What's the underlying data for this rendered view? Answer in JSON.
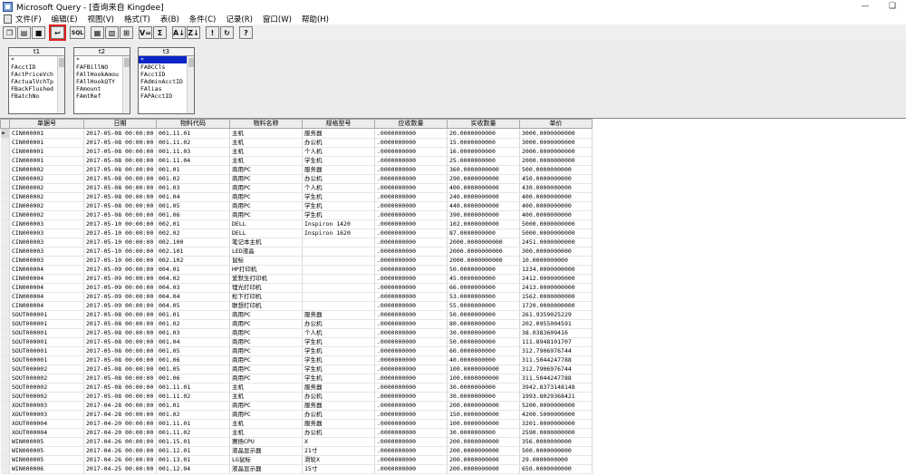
{
  "window": {
    "title": "Microsoft Query - [查询来自 Kingdee]",
    "controls": [
      "—",
      "❏"
    ]
  },
  "menu": [
    "文件(F)",
    "编辑(E)",
    "视图(V)",
    "格式(T)",
    "表(B)",
    "条件(C)",
    "记录(R)",
    "窗口(W)",
    "帮助(H)"
  ],
  "toolbar": {
    "buttons": [
      {
        "name": "new-query-button",
        "glyph": "❐"
      },
      {
        "name": "open-query-button",
        "glyph": "▤"
      },
      {
        "name": "save-query-button",
        "glyph": "■"
      },
      {
        "name": "return-data-button",
        "glyph": "↩",
        "highlight": true
      },
      {
        "name": "view-sql-button",
        "glyph": "SQL",
        "wide": true
      },
      {
        "name": "show-tables-button",
        "glyph": "▦"
      },
      {
        "name": "show-criteria-button",
        "glyph": "▧"
      },
      {
        "name": "add-tables-button",
        "glyph": "⊞"
      },
      {
        "name": "criteria-equals-button",
        "glyph": "V="
      },
      {
        "name": "totals-button",
        "glyph": "Σ"
      },
      {
        "name": "sort-ascending-button",
        "glyph": "A↓"
      },
      {
        "name": "sort-descending-button",
        "glyph": "Z↓"
      },
      {
        "name": "query-now-button",
        "glyph": "!"
      },
      {
        "name": "auto-query-button",
        "glyph": "↻"
      },
      {
        "name": "help-button",
        "glyph": "?"
      }
    ]
  },
  "tables": [
    {
      "title": "t1",
      "fields": [
        "*",
        "FAcctID",
        "FActPriceVch",
        "FActualVchTp",
        "FBackFlushed",
        "FBatchNo"
      ],
      "selected": -1
    },
    {
      "title": "t2",
      "fields": [
        "*",
        "FAFBillNO",
        "FAllHookAmou",
        "FAllHookQTY",
        "FAmount",
        "FAmtRef"
      ],
      "selected": -1
    },
    {
      "title": "t3",
      "fields": [
        "*",
        "FABCCls",
        "FAcctID",
        "FAdminAcctID",
        "FAlias",
        "FAPAcctID"
      ],
      "selected": 0
    }
  ],
  "grid": {
    "columns": [
      "单据号",
      "日期",
      "物料代码",
      "物料名称",
      "规格型号",
      "应收数量",
      "实收数量",
      "单价"
    ],
    "rows": [
      [
        "CIN000001",
        "2017-05-08 00:00:00",
        "001.11.01",
        "主机",
        "服务器",
        ".0000000000",
        "20.0000000000",
        "3000.0000000000"
      ],
      [
        "CIN000001",
        "2017-05-08 00:00:00",
        "001.11.02",
        "主机",
        "办公机",
        ".0000000000",
        "15.0000000000",
        "3000.0000000000"
      ],
      [
        "CIN000001",
        "2017-05-08 00:00:00",
        "001.11.03",
        "主机",
        "个人机",
        ".0000000000",
        "16.0000000000",
        "2000.0000000000"
      ],
      [
        "CIN000001",
        "2017-05-08 00:00:00",
        "001.11.04",
        "主机",
        "学生机",
        ".0000000000",
        "25.0000000000",
        "2000.0000000000"
      ],
      [
        "CIN000002",
        "2017-05-08 00:00:00",
        "001.01",
        "商用PC",
        "服务器",
        ".0000000000",
        "360.0000000000",
        "500.0000000000"
      ],
      [
        "CIN000002",
        "2017-05-08 00:00:00",
        "001.02",
        "商用PC",
        "办公机",
        ".0000000000",
        "290.0000000000",
        "450.0000000000"
      ],
      [
        "CIN000002",
        "2017-05-08 00:00:00",
        "001.03",
        "商用PC",
        "个人机",
        ".0000000000",
        "400.0000000000",
        "430.0000000000"
      ],
      [
        "CIN000002",
        "2017-05-08 00:00:00",
        "001.04",
        "商用PC",
        "学生机",
        ".0000000000",
        "240.0000000000",
        "400.0000000000"
      ],
      [
        "CIN000002",
        "2017-05-08 00:00:00",
        "001.05",
        "商用PC",
        "学生机",
        ".0000000000",
        "440.0000000000",
        "400.0000000000"
      ],
      [
        "CIN000002",
        "2017-05-08 00:00:00",
        "001.06",
        "商用PC",
        "学生机",
        ".0000000000",
        "390.0000000000",
        "400.0000000000"
      ],
      [
        "CIN000003",
        "2017-05-10 00:00:00",
        "002.01",
        "DELL",
        "Inspiron 1420",
        ".0000000000",
        "102.0000000000",
        "5000.0000000000"
      ],
      [
        "CIN000003",
        "2017-05-10 00:00:00",
        "002.02",
        "DELL",
        "Inspiron 1620",
        ".0000000000",
        "87.0000000000",
        "5000.0000000000"
      ],
      [
        "CIN000003",
        "2017-05-10 00:00:00",
        "002.100",
        "笔记本主机",
        "",
        ".0000000000",
        "2000.0000000000",
        "2451.0000000000"
      ],
      [
        "CIN000003",
        "2017-05-10 00:00:00",
        "002.101",
        "LED液晶",
        "",
        ".0000000000",
        "2000.0000000000",
        "300.0000000000"
      ],
      [
        "CIN000003",
        "2017-05-10 00:00:00",
        "002.102",
        "鼠标",
        "",
        ".0000000000",
        "2000.0000000000",
        "10.0000000000"
      ],
      [
        "CIN000004",
        "2017-05-09 00:00:00",
        "004.01",
        "HP打印机",
        "",
        ".0000000000",
        "50.0000000000",
        "1234.0000000000"
      ],
      [
        "CIN000004",
        "2017-05-09 00:00:00",
        "004.02",
        "爱默生打印机",
        "",
        ".0000000000",
        "45.0000000000",
        "2412.0000000000"
      ],
      [
        "CIN000004",
        "2017-05-09 00:00:00",
        "004.03",
        "理光打印机",
        "",
        ".0000000000",
        "66.0000000000",
        "2413.0000000000"
      ],
      [
        "CIN000004",
        "2017-05-09 00:00:00",
        "004.04",
        "松下打印机",
        "",
        ".0000000000",
        "53.0000000000",
        "1562.0000000000"
      ],
      [
        "CIN000004",
        "2017-05-09 00:00:00",
        "004.05",
        "联想打印机",
        "",
        ".0000000000",
        "55.0000000000",
        "1720.0000000000"
      ],
      [
        "SOUT000001",
        "2017-05-08 00:00:00",
        "001.01",
        "商用PC",
        "服务器",
        ".0000000000",
        "50.0000000000",
        "261.9359025229"
      ],
      [
        "SOUT000001",
        "2017-05-08 00:00:00",
        "001.02",
        "商用PC",
        "办公机",
        ".0000000000",
        "80.0000000000",
        "202.0955004591"
      ],
      [
        "SOUT000001",
        "2017-05-08 00:00:00",
        "001.03",
        "商用PC",
        "个人机",
        ".0000000000",
        "30.0000000000",
        "38.0383609416"
      ],
      [
        "SOUT000001",
        "2017-05-08 00:00:00",
        "001.04",
        "商用PC",
        "学生机",
        ".0000000000",
        "50.0000000000",
        "111.8948101707"
      ],
      [
        "SOUT000001",
        "2017-05-08 00:00:00",
        "001.05",
        "商用PC",
        "学生机",
        ".0000000000",
        "60.0000000000",
        "312.7906976744"
      ],
      [
        "SOUT000001",
        "2017-05-08 00:00:00",
        "001.06",
        "商用PC",
        "学生机",
        ".0000000000",
        "40.0000000000",
        "311.5044247788"
      ],
      [
        "SOUT000002",
        "2017-05-08 00:00:00",
        "001.05",
        "商用PC",
        "学生机",
        ".0000000000",
        "100.0000000000",
        "312.7906976744"
      ],
      [
        "SOUT000002",
        "2017-05-08 00:00:00",
        "001.06",
        "商用PC",
        "学生机",
        ".0000000000",
        "100.0000000000",
        "311.5044247788"
      ],
      [
        "SOUT000002",
        "2017-05-08 00:00:00",
        "001.11.01",
        "主机",
        "服务器",
        ".0000000000",
        "30.0000000000",
        "3942.8373148148"
      ],
      [
        "SOUT000002",
        "2017-05-08 00:00:00",
        "001.11.02",
        "主机",
        "办公机",
        ".0000000000",
        "30.0000000000",
        "1993.8029368421"
      ],
      [
        "XOUT000003",
        "2017-04-28 00:00:00",
        "001.01",
        "商用PC",
        "服务器",
        ".0000000000",
        "200.0000000000",
        "5200.0000000000"
      ],
      [
        "XOUT000003",
        "2017-04-28 00:00:00",
        "001.02",
        "商用PC",
        "办公机",
        ".0000000000",
        "150.0000000000",
        "4200.5000000000"
      ],
      [
        "XOUT000004",
        "2017-04-20 00:00:00",
        "001.11.01",
        "主机",
        "服务器",
        ".0000000000",
        "100.0000000000",
        "3201.0000000000"
      ],
      [
        "XOUT000004",
        "2017-04-20 00:00:00",
        "001.11.02",
        "主机",
        "办公机",
        ".0000000000",
        "30.0000000000",
        "2590.0000000000"
      ],
      [
        "WIN000005",
        "2017-04-26 00:00:00",
        "001.15.01",
        "赛扬CPU",
        "X",
        ".0000000000",
        "200.0000000000",
        "356.0000000000"
      ],
      [
        "WIN000005",
        "2017-04-26 00:00:00",
        "001.12.01",
        "液晶显示器",
        "21寸",
        ".0000000000",
        "200.0000000000",
        "500.0000000000"
      ],
      [
        "WIN000005",
        "2017-04-26 00:00:00",
        "001.13.01",
        "LG鼠标",
        "滑轮X",
        ".0000000000",
        "200.0000000000",
        "29.0000000000"
      ],
      [
        "WIN000006",
        "2017-04-25 00:00:00",
        "001.12.04",
        "液晶显示器",
        "15寸",
        ".0000000000",
        "200.0000000000",
        "650.0000000000"
      ]
    ]
  }
}
